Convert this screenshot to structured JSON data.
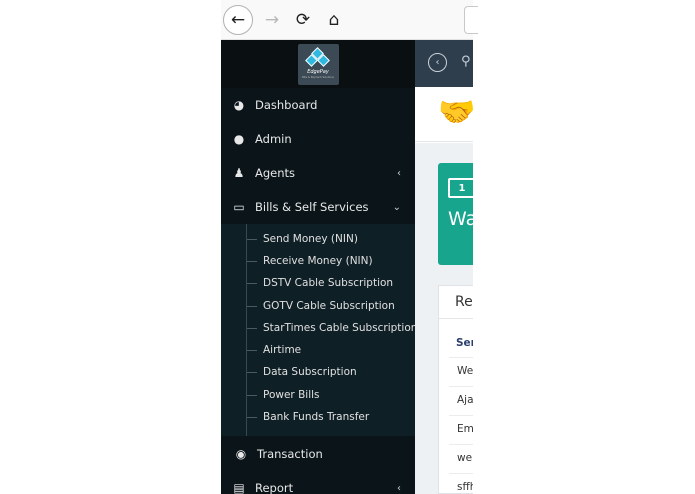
{
  "browser": {
    "back_glyph": "←",
    "forward_glyph": "→",
    "reload_glyph": "⟳",
    "home_glyph": "⌂"
  },
  "brand": {
    "logo_text": "EdgePay",
    "logo_subtext": "Bills & Payment Solutions"
  },
  "sidebar": {
    "items": [
      {
        "label": "Dashboard",
        "icon": "dashboard-icon",
        "glyph": "◕"
      },
      {
        "label": "Admin",
        "icon": "user-circle-icon",
        "glyph": "●"
      },
      {
        "label": "Agents",
        "icon": "users-icon",
        "glyph": "♟",
        "caret": "‹"
      },
      {
        "label": "Bills & Self Services",
        "icon": "credit-card-icon",
        "glyph": "▭",
        "caret": "⌄"
      },
      {
        "label": "Transaction",
        "icon": "circle-dot-icon",
        "glyph": "◉"
      },
      {
        "label": "Report",
        "icon": "file-icon",
        "glyph": "▤",
        "caret": "‹"
      }
    ],
    "submenu": [
      "Send Money (NIN)",
      "Receive Money (NIN)",
      "DSTV Cable Subscription",
      "GOTV Cable Subscription",
      "StarTimes Cable Subscription",
      "Airtime",
      "Data Subscription",
      "Power Bills",
      "Bank Funds Transfer"
    ]
  },
  "topbar": {
    "collapse_glyph": "‹",
    "search_glyph": "⚲"
  },
  "header": {
    "handshake_glyph": "🤝"
  },
  "wallet_card": {
    "money_glyph": "1",
    "title": "Wa"
  },
  "panel": {
    "title": "Re",
    "column_header": "Ser",
    "rows": [
      "We",
      "Aja",
      "Em",
      "wel",
      "sffh"
    ]
  },
  "colors": {
    "sidebar_bg": "#0a1419",
    "submenu_bg": "#0f1f26",
    "topbar_bg": "#2f3e4d",
    "accent": "#18a58e"
  }
}
